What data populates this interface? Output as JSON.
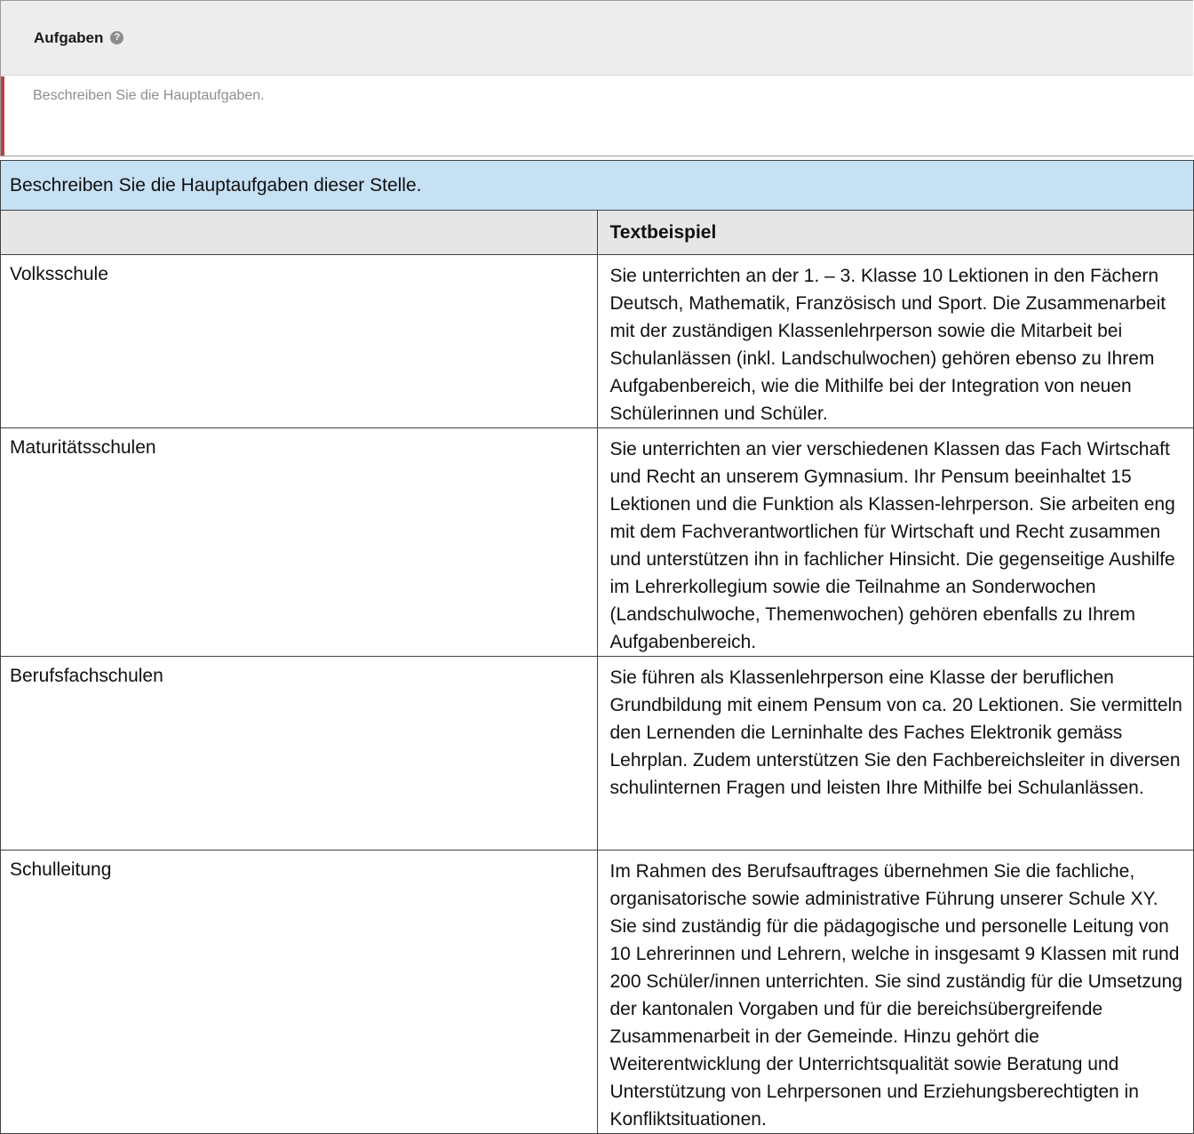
{
  "form": {
    "title": "Aufgaben",
    "help_icon": "question-circle-icon",
    "placeholder": "Beschreiben Sie die Hauptaufgaben.",
    "error_border_color": "#b94040"
  },
  "help": {
    "intro": "Beschreiben Sie die Hauptaufgaben dieser Stelle.",
    "header": {
      "col1": "",
      "col2": "Textbeispiel"
    },
    "rows": [
      {
        "type": "Volksschule",
        "text": "Sie unterrichten an der 1. – 3. Klasse 10 Lektionen in den Fächern Deutsch, Mathematik, Französisch und Sport. Die Zusammenarbeit mit der zuständigen Klassenlehrperson sowie die Mitarbeit bei Schulanlässen (inkl. Landschulwochen) gehören ebenso zu Ihrem Aufgabenbereich, wie die Mithilfe bei der Integration von neuen Schülerinnen und Schüler."
      },
      {
        "type": "Maturitätsschulen",
        "text": "Sie unterrichten an vier verschiedenen Klassen das Fach Wirtschaft und Recht an unserem Gymnasium. Ihr Pensum beeinhaltet 15 Lektionen und die Funktion als Klassen-lehrperson. Sie arbeiten eng mit dem Fachverantwortlichen für Wirtschaft und Recht zusammen und unterstützen ihn in fachlicher Hinsicht. Die gegenseitige Aushilfe im Lehrerkollegium sowie die Teilnahme an Sonderwochen (Landschulwoche, Themenwochen) gehören ebenfalls zu Ihrem Aufgabenbereich."
      },
      {
        "type": "Berufsfachschulen",
        "text": "Sie führen als Klassenlehrperson eine Klasse der beruflichen Grundbildung mit einem Pensum von ca. 20 Lektionen. Sie vermitteln den Lernenden die Lerninhalte des Faches Elektronik gemäss Lehrplan. Zudem unterstützen Sie den Fachbereichsleiter in diversen schulinternen Fragen und leisten Ihre Mithilfe bei Schulanlässen."
      },
      {
        "type": "Schulleitung",
        "text": "Im Rahmen des Berufsauftrages übernehmen Sie die fachliche, organisatorische sowie administrative Führung unserer Schule XY. Sie sind zuständig für die pädagogische und personelle Leitung von 10 Lehrerinnen und Lehrern, welche in insgesamt 9 Klassen mit rund 200 Schüler/innen unterrichten. Sie sind zuständig für die Umsetzung der kantonalen Vorgaben und für die bereichsübergreifende Zusammenarbeit in der Gemeinde. Hinzu gehört die Weiterentwicklung der Unterrichtsqualität sowie Beratung und Unterstützung von Lehrpersonen und Erziehungsberechtigten in Konfliktsituationen."
      }
    ]
  }
}
